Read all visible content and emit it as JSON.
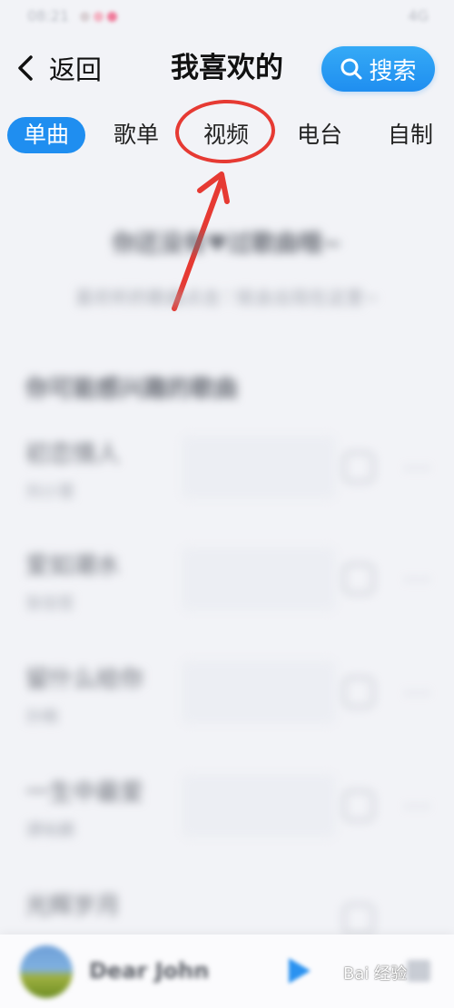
{
  "status_bar": {
    "time": "08:21",
    "right": "4G"
  },
  "header": {
    "back_label": "返回",
    "title": "我喜欢的",
    "search_label": "搜索"
  },
  "tabs": [
    {
      "label": "单曲",
      "active": true
    },
    {
      "label": "歌单",
      "active": false
    },
    {
      "label": "视频",
      "active": false
    },
    {
      "label": "电台",
      "active": false
    },
    {
      "label": "自制",
      "active": false
    }
  ],
  "empty_state": {
    "title": "你还没有♥过歌曲哦~",
    "subtitle": "喜欢听的歌曲点击♡就会出现在这里~"
  },
  "recommend": {
    "title": "你可能感兴趣的歌曲",
    "songs": [
      {
        "title": "初恋情人",
        "artist": "刘小慧"
      },
      {
        "title": "爱如潮水",
        "artist": "张信哲"
      },
      {
        "title": "留什么给你",
        "artist": "孙楠"
      },
      {
        "title": "一生中最爱",
        "artist": "谭咏麟"
      },
      {
        "title": "光辉岁月",
        "artist": ""
      }
    ]
  },
  "player": {
    "title": "Dear John"
  },
  "watermark": {
    "text": "Bai  经验"
  },
  "colors": {
    "accent": "#1f8ef0",
    "annotation": "#e63a33"
  }
}
